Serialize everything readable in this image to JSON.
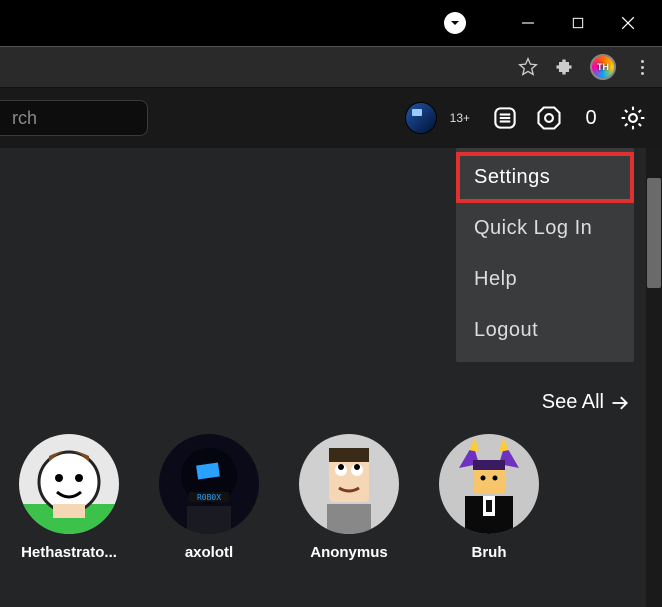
{
  "browser": {
    "profile_initials": "TH"
  },
  "header": {
    "search_placeholder": "rch",
    "age_badge": "13+",
    "robux_count": "0"
  },
  "dropdown": {
    "items": [
      {
        "label": "Settings",
        "highlighted": true
      },
      {
        "label": "Quick Log In",
        "highlighted": false
      },
      {
        "label": "Help",
        "highlighted": false
      },
      {
        "label": "Logout",
        "highlighted": false
      }
    ]
  },
  "see_all_label": "See All",
  "friends": [
    {
      "name": "Hethastrato..."
    },
    {
      "name": "axolotl"
    },
    {
      "name": "Anonymus"
    },
    {
      "name": "Bruh"
    }
  ]
}
